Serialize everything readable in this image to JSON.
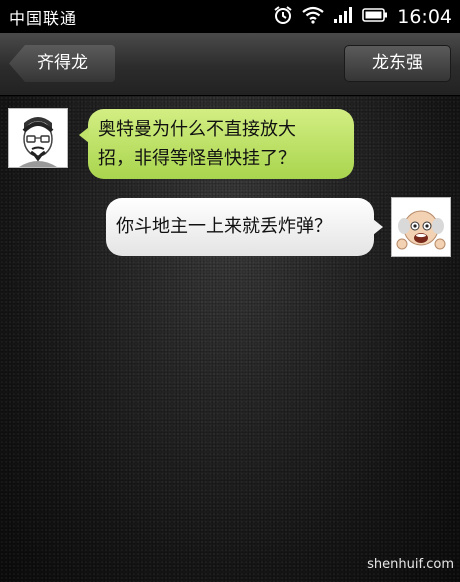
{
  "status_bar": {
    "carrier": "中国联通",
    "time": "16:04"
  },
  "header": {
    "back_label": "齐得龙",
    "contact_label": "龙东强"
  },
  "messages": [
    {
      "side": "left",
      "sender": "齐得龙",
      "text_line1": "奥特曼为什么不直接放大",
      "text_line2": "招，非得等怪兽快挂了？"
    },
    {
      "side": "right",
      "sender": "龙东强",
      "text": "你斗地主一上来就丢炸弹？"
    }
  ],
  "watermark": "shenhuif.com",
  "colors": {
    "incoming_bubble": "#b9df5c",
    "outgoing_bubble": "#f2f2f2",
    "status_bar": "#000000"
  },
  "icons": [
    "alarm-icon",
    "wifi-icon",
    "signal-icon",
    "battery-icon"
  ]
}
